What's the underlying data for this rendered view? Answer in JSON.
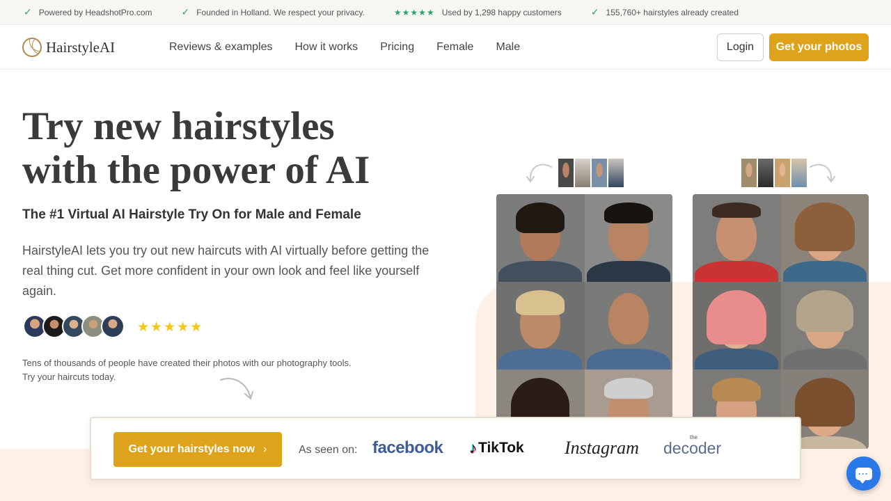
{
  "topbar": {
    "items": [
      "Powered by HeadshotPro.com",
      "Founded in Holland. We respect your privacy.",
      "Used by 1,298 happy customers",
      "155,760+ hairstyles already created"
    ],
    "stars": "★★★★★"
  },
  "nav": {
    "brand": "HairstyleAI",
    "links": [
      "Reviews & examples",
      "How it works",
      "Pricing",
      "Female",
      "Male"
    ],
    "login": "Login",
    "cta": "Get your photos"
  },
  "hero": {
    "title_line1": "Try new hairstyles",
    "title_line2": "with the power of AI",
    "subtitle": "The #1 Virtual AI Hairstyle Try On for Male and Female",
    "description": "HairstyleAI lets you try out new haircuts with AI virtually before getting the real thing cut. Get more confident in your own look and feel like yourself again.",
    "rating": "★★★★★",
    "rating_value": 5,
    "social_proof": "Tens of thousands of people have created their photos with our photography tools. Try your haircuts today."
  },
  "cta_bar": {
    "button": "Get your hairstyles now",
    "chevron": "›",
    "as_seen_label": "As seen on:",
    "press": [
      "facebook",
      "TikTok",
      "Instagram",
      "decoder"
    ],
    "decoder_prefix": "the"
  },
  "colors": {
    "accent": "#dea21b",
    "check": "#2ca36b",
    "star": "#f5c518",
    "peach": "#fdf1e7",
    "chat": "#2979e8"
  },
  "icons": [
    "check-icon",
    "hairstyleai-logo-icon",
    "curved-arrow-icon",
    "chat-icon"
  ]
}
